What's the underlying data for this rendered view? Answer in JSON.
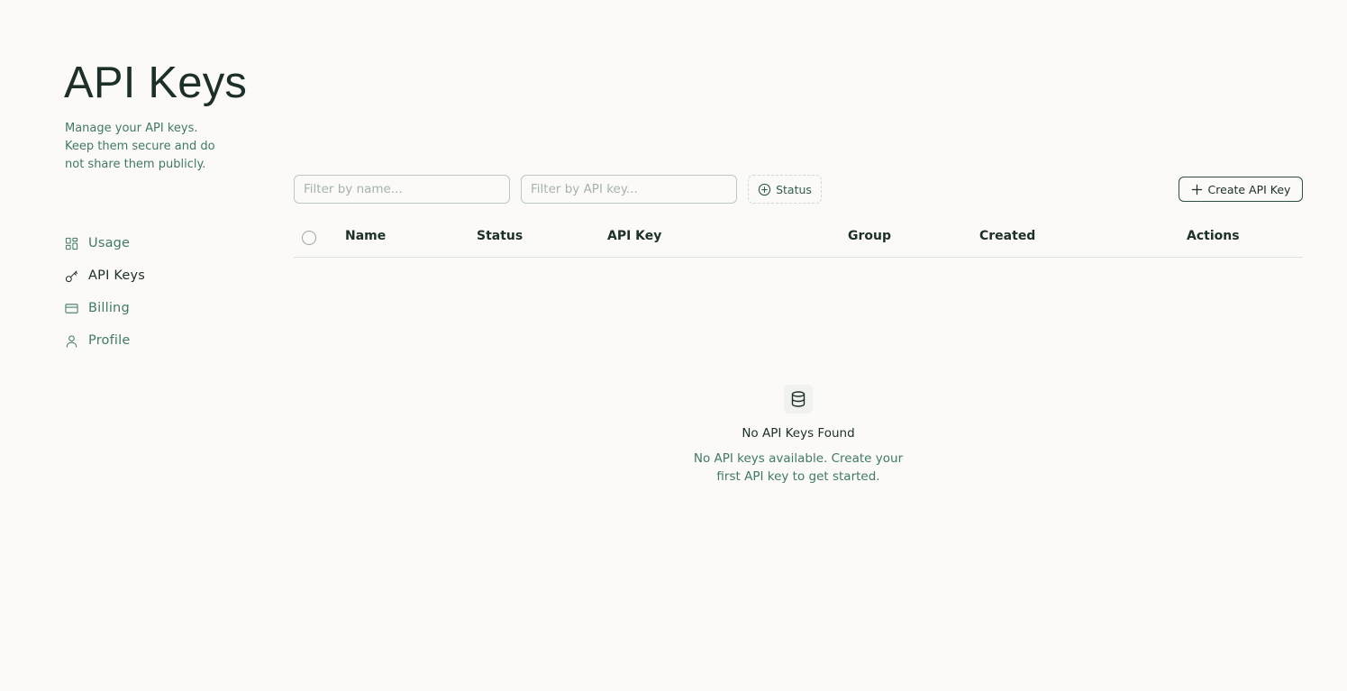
{
  "header": {
    "title": "API Keys",
    "description": "Manage your API keys. Keep them secure and do not share them publicly."
  },
  "sidebar": {
    "items": [
      {
        "label": "Usage",
        "icon": "grid-icon",
        "active": false
      },
      {
        "label": "API Keys",
        "icon": "key-icon",
        "active": true
      },
      {
        "label": "Billing",
        "icon": "credit-card-icon",
        "active": false
      },
      {
        "label": "Profile",
        "icon": "user-icon",
        "active": false
      }
    ]
  },
  "toolbar": {
    "name_filter": {
      "placeholder": "Filter by name...",
      "value": ""
    },
    "key_filter": {
      "placeholder": "Filter by API key...",
      "value": ""
    },
    "status_label": "Status",
    "create_label": "Create API Key"
  },
  "table": {
    "columns": [
      "Name",
      "Status",
      "API Key",
      "Group",
      "Created",
      "Actions"
    ],
    "rows": []
  },
  "empty_state": {
    "icon": "database-icon",
    "title": "No API Keys Found",
    "description": "No API keys available. Create your first API key to get started."
  },
  "colors": {
    "background": "#fbfaf7",
    "text_primary": "#1c2f29",
    "text_accent": "#3f7a66",
    "border": "#bcc9c2"
  }
}
